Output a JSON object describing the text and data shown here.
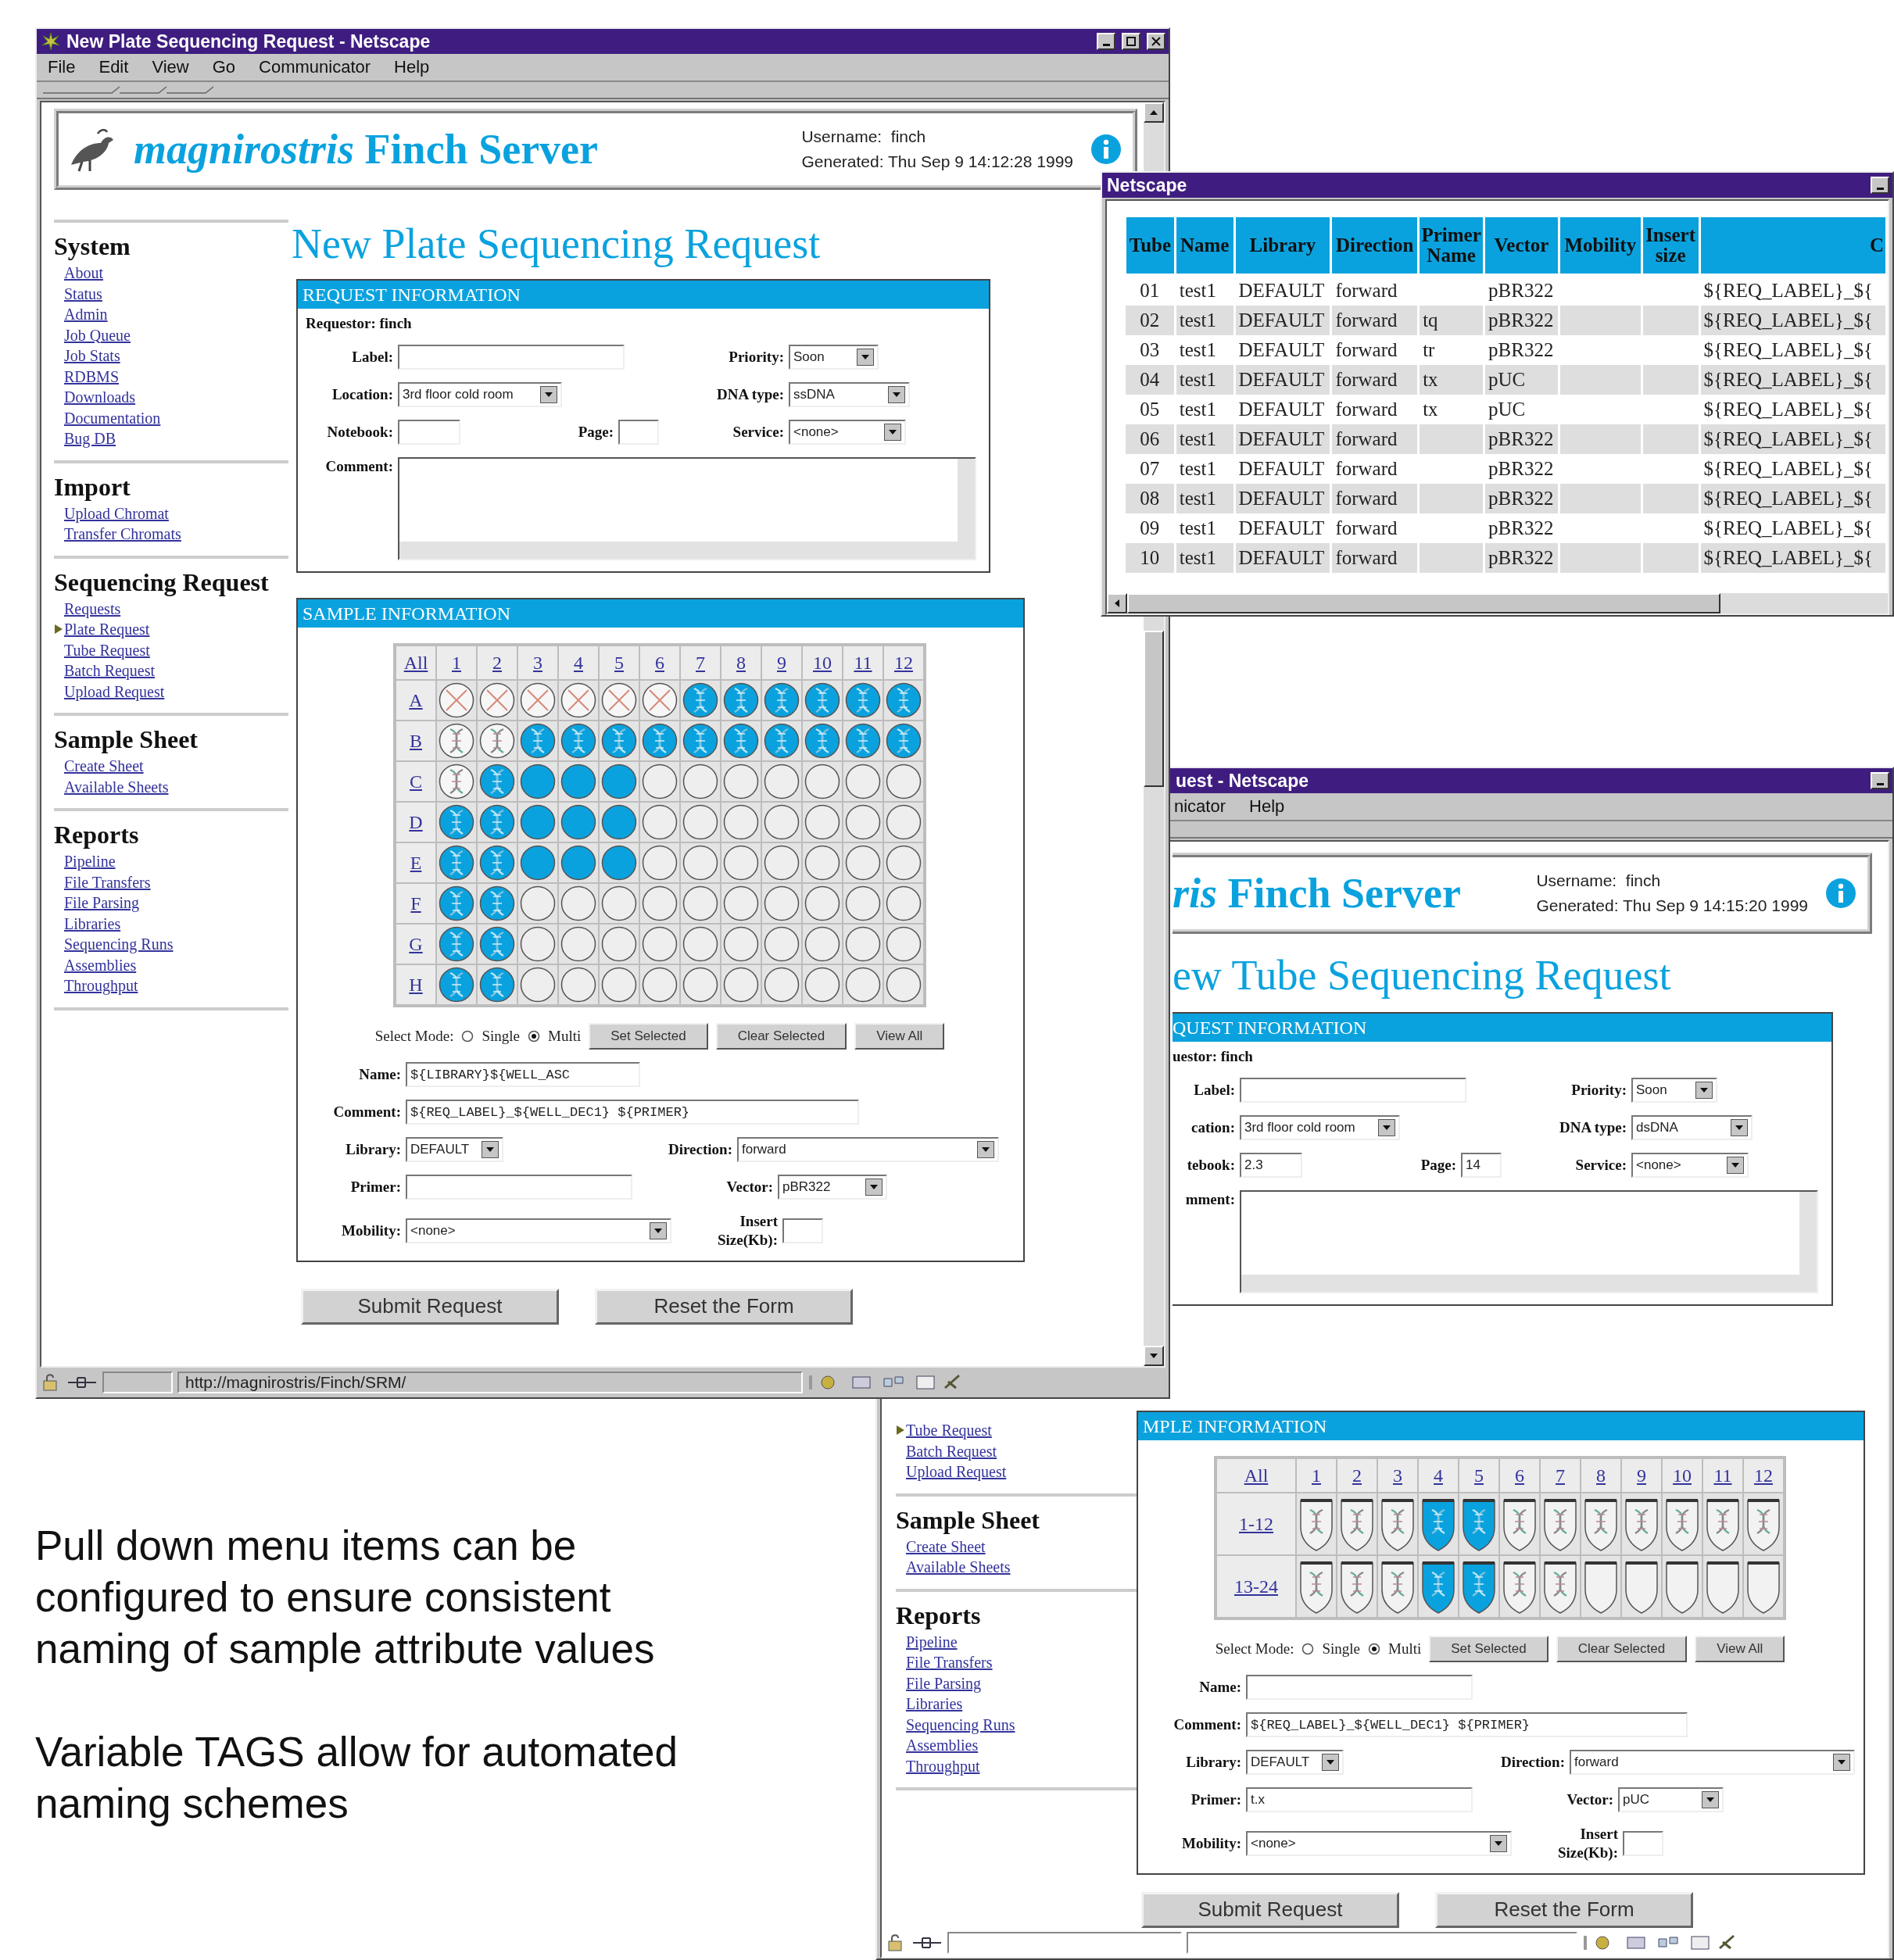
{
  "plate_window": {
    "title": "New Plate Sequencing Request - Netscape",
    "menu": [
      "File",
      "Edit",
      "View",
      "Go",
      "Communicator",
      "Help"
    ],
    "site_header": {
      "logo": "*magnirostris* Finch Server",
      "username": "Username:  finch",
      "generated": "Generated: Thu Sep 9 14:12:28 1999"
    },
    "page_title": "New Plate Sequencing Request",
    "sidebar": [
      {
        "heading": "System",
        "links": [
          {
            "label": "About",
            "selected": false
          },
          {
            "label": "Status",
            "selected": false
          },
          {
            "label": "Admin",
            "selected": false
          },
          {
            "label": "Job Queue",
            "selected": false
          },
          {
            "label": "Job Stats",
            "selected": false
          },
          {
            "label": "RDBMS",
            "selected": false
          },
          {
            "label": "Downloads",
            "selected": false
          },
          {
            "label": "Documentation",
            "selected": false
          },
          {
            "label": "Bug DB",
            "selected": false
          }
        ]
      },
      {
        "heading": "Import",
        "links": [
          {
            "label": "Upload Chromat",
            "selected": false
          },
          {
            "label": "Transfer Chromats",
            "selected": false
          }
        ]
      },
      {
        "heading": "Sequencing Request",
        "links": [
          {
            "label": "Requests",
            "selected": false
          },
          {
            "label": "Plate Request",
            "selected": true
          },
          {
            "label": "Tube Request",
            "selected": false
          },
          {
            "label": "Batch Request",
            "selected": false
          },
          {
            "label": "Upload Request",
            "selected": false
          }
        ]
      },
      {
        "heading": "Sample Sheet",
        "links": [
          {
            "label": "Create Sheet",
            "selected": false
          },
          {
            "label": "Available Sheets",
            "selected": false
          }
        ]
      },
      {
        "heading": "Reports",
        "links": [
          {
            "label": "Pipeline",
            "selected": false
          },
          {
            "label": "File Transfers",
            "selected": false
          },
          {
            "label": "File Parsing",
            "selected": false
          },
          {
            "label": "Libraries",
            "selected": false
          },
          {
            "label": "Sequencing Runs",
            "selected": false
          },
          {
            "label": "Assemblies",
            "selected": false
          },
          {
            "label": "Throughput",
            "selected": false
          }
        ]
      }
    ],
    "request_info": {
      "title": "REQUEST INFORMATION",
      "requestor": "Requestor: finch",
      "rows": [
        [
          {
            "label": "Label:",
            "kind": "text"
          },
          {
            "label": "Priority:",
            "kind": "select",
            "value": "Soon"
          }
        ],
        [
          {
            "label": "Location:",
            "kind": "select",
            "value": "3rd floor cold room"
          },
          {
            "label": "DNA type:",
            "kind": "select",
            "value": "ssDNA"
          }
        ],
        [
          {
            "label": "Notebook:",
            "kind": "text"
          },
          {
            "label": "Page:",
            "kind": "text"
          },
          {
            "label": "Service:",
            "kind": "select",
            "value": "<none>"
          }
        ],
        [
          {
            "label": "Comment:",
            "kind": "textarea"
          }
        ]
      ]
    },
    "sample_info": {
      "title": "SAMPLE INFORMATION",
      "grid": {
        "kind": "plate",
        "columns": [
          "All",
          "1",
          "2",
          "3",
          "4",
          "5",
          "6",
          "7",
          "8",
          "9",
          "10",
          "11",
          "12"
        ],
        "rows": [
          {
            "label": "A",
            "cells": [
              {
                "kind": "crossed"
              },
              {
                "kind": "crossed"
              },
              {
                "kind": "crossed"
              },
              {
                "kind": "crossed"
              },
              {
                "kind": "crossed"
              },
              {
                "kind": "crossed"
              },
              {
                "kind": "selected"
              },
              {
                "kind": "selected"
              },
              {
                "kind": "selected"
              },
              {
                "kind": "selected"
              },
              {
                "kind": "selected"
              },
              {
                "kind": "selected"
              }
            ]
          },
          {
            "label": "B",
            "cells": [
              {
                "kind": "dna"
              },
              {
                "kind": "dna"
              },
              {
                "kind": "selected"
              },
              {
                "kind": "selected"
              },
              {
                "kind": "selected"
              },
              {
                "kind": "selected"
              },
              {
                "kind": "selected"
              },
              {
                "kind": "selected"
              },
              {
                "kind": "selected"
              },
              {
                "kind": "selected"
              },
              {
                "kind": "selected"
              },
              {
                "kind": "selected"
              }
            ]
          },
          {
            "label": "C",
            "cells": [
              {
                "kind": "dna"
              },
              {
                "kind": "selected"
              },
              {
                "kind": "filled"
              },
              {
                "kind": "filled"
              },
              {
                "kind": "filled"
              },
              {
                "kind": "empty"
              },
              {
                "kind": "empty"
              },
              {
                "kind": "empty"
              },
              {
                "kind": "empty"
              },
              {
                "kind": "empty"
              },
              {
                "kind": "empty"
              },
              {
                "kind": "empty"
              }
            ]
          },
          {
            "label": "D",
            "cells": [
              {
                "kind": "selected"
              },
              {
                "kind": "selected"
              },
              {
                "kind": "filled"
              },
              {
                "kind": "filled"
              },
              {
                "kind": "filled"
              },
              {
                "kind": "empty"
              },
              {
                "kind": "empty"
              },
              {
                "kind": "empty"
              },
              {
                "kind": "empty"
              },
              {
                "kind": "empty"
              },
              {
                "kind": "empty"
              },
              {
                "kind": "empty"
              }
            ]
          },
          {
            "label": "E",
            "cells": [
              {
                "kind": "selected"
              },
              {
                "kind": "selected"
              },
              {
                "kind": "filled"
              },
              {
                "kind": "filled"
              },
              {
                "kind": "filled"
              },
              {
                "kind": "empty"
              },
              {
                "kind": "empty"
              },
              {
                "kind": "empty"
              },
              {
                "kind": "empty"
              },
              {
                "kind": "empty"
              },
              {
                "kind": "empty"
              },
              {
                "kind": "empty"
              }
            ]
          },
          {
            "label": "F",
            "cells": [
              {
                "kind": "selected"
              },
              {
                "kind": "selected"
              },
              {
                "kind": "empty"
              },
              {
                "kind": "empty"
              },
              {
                "kind": "empty"
              },
              {
                "kind": "empty"
              },
              {
                "kind": "empty"
              },
              {
                "kind": "empty"
              },
              {
                "kind": "empty"
              },
              {
                "kind": "empty"
              },
              {
                "kind": "empty"
              },
              {
                "kind": "empty"
              }
            ]
          },
          {
            "label": "G",
            "cells": [
              {
                "kind": "selected"
              },
              {
                "kind": "selected"
              },
              {
                "kind": "empty"
              },
              {
                "kind": "empty"
              },
              {
                "kind": "empty"
              },
              {
                "kind": "empty"
              },
              {
                "kind": "empty"
              },
              {
                "kind": "empty"
              },
              {
                "kind": "empty"
              },
              {
                "kind": "empty"
              },
              {
                "kind": "empty"
              },
              {
                "kind": "empty"
              }
            ]
          },
          {
            "label": "H",
            "cells": [
              {
                "kind": "selected"
              },
              {
                "kind": "selected"
              },
              {
                "kind": "empty"
              },
              {
                "kind": "empty"
              },
              {
                "kind": "empty"
              },
              {
                "kind": "empty"
              },
              {
                "kind": "empty"
              },
              {
                "kind": "empty"
              },
              {
                "kind": "empty"
              },
              {
                "kind": "empty"
              },
              {
                "kind": "empty"
              },
              {
                "kind": "empty"
              }
            ]
          }
        ]
      },
      "select_mode": {
        "label": "Select Mode:",
        "options": [
          {
            "label": "Single",
            "selected": false
          },
          {
            "label": "Multi",
            "selected": true
          }
        ]
      },
      "actions": [
        "Set Selected",
        "Clear Selected",
        "View All"
      ],
      "rows": [
        [
          {
            "label": "Name:",
            "kind": "template",
            "value": "${LIBRARY}${WELL_ASC"
          }
        ],
        [
          {
            "label": "Comment:",
            "kind": "template",
            "value": "${REQ_LABEL}_${WELL_DEC1} ${PRIMER}"
          }
        ],
        [
          {
            "label": "Library:",
            "kind": "select",
            "value": "DEFAULT"
          },
          {
            "label": "Direction:",
            "kind": "select",
            "value": "forward"
          }
        ],
        [
          {
            "label": "Primer:",
            "kind": "text"
          },
          {
            "label": "Vector:",
            "kind": "select",
            "value": "pBR322"
          }
        ],
        [
          {
            "label": "Mobility:",
            "kind": "select",
            "value": "<none>"
          },
          {
            "label": "Insert Size(Kb):",
            "kind": "text"
          }
        ]
      ]
    },
    "buttons": [
      "Submit Request",
      "Reset the Form"
    ],
    "status_url": "http://magnirostris/Finch/SRM/"
  },
  "table_window": {
    "title": "Netscape",
    "columns": [
      "Tube",
      "Name",
      "Library",
      "Direction",
      "Primer Name",
      "Vector",
      "Mobility",
      "Insert size",
      "C"
    ],
    "rows": [
      {
        "tube": "01",
        "name": "test1",
        "library": "DEFAULT",
        "direction": "forward",
        "vector": "pBR322",
        "column_9": "${REQ_LABEL}_${"
      },
      {
        "tube": "02",
        "name": "test1",
        "library": "DEFAULT",
        "direction": "forward",
        "primer_name": "tq",
        "vector": "pBR322",
        "column_9": "${REQ_LABEL}_${"
      },
      {
        "tube": "03",
        "name": "test1",
        "library": "DEFAULT",
        "direction": "forward",
        "primer_name": "tr",
        "vector": "pBR322",
        "column_9": "${REQ_LABEL}_${"
      },
      {
        "tube": "04",
        "name": "test1",
        "library": "DEFAULT",
        "direction": "forward",
        "primer_name": "tx",
        "vector": "pUC",
        "column_9": "${REQ_LABEL}_${"
      },
      {
        "tube": "05",
        "name": "test1",
        "library": "DEFAULT",
        "direction": "forward",
        "primer_name": "tx",
        "vector": "pUC",
        "column_9": "${REQ_LABEL}_${"
      },
      {
        "tube": "06",
        "name": "test1",
        "library": "DEFAULT",
        "direction": "forward",
        "vector": "pBR322",
        "column_9": "${REQ_LABEL}_${"
      },
      {
        "tube": "07",
        "name": "test1",
        "library": "DEFAULT",
        "direction": "forward",
        "vector": "pBR322",
        "column_9": "${REQ_LABEL}_${"
      },
      {
        "tube": "08",
        "name": "test1",
        "library": "DEFAULT",
        "direction": "forward",
        "vector": "pBR322",
        "column_9": "${REQ_LABEL}_${"
      },
      {
        "tube": "09",
        "name": "test1",
        "library": "DEFAULT",
        "direction": "forward",
        "vector": "pBR322",
        "column_9": "${REQ_LABEL}_${"
      },
      {
        "tube": "10",
        "name": "test1",
        "library": "DEFAULT",
        "direction": "forward",
        "vector": "pBR322",
        "column_9": "${REQ_LABEL}_${"
      }
    ]
  },
  "tube_window": {
    "title": "uest - Netscape",
    "menu": [
      "nicator",
      "Help"
    ],
    "site_header": {
      "logo": "*ris* Finch Server",
      "username": "Username:  finch",
      "generated": "Generated: Thu Sep 9 14:15:20 1999"
    },
    "page_title": "ew Tube Sequencing Request",
    "request_info": {
      "title": "QUEST INFORMATION",
      "requestor": "uestor: finch",
      "rows": [
        [
          {
            "label": "Label:",
            "kind": "text"
          },
          {
            "label": "Priority:",
            "kind": "select",
            "value": "Soon"
          }
        ],
        [
          {
            "label": "cation:",
            "kind": "select",
            "value": "3rd floor cold room"
          },
          {
            "label": "DNA type:",
            "kind": "select",
            "value": "dsDNA"
          }
        ],
        [
          {
            "label": "tebook:",
            "kind": "text",
            "value": "2.3"
          },
          {
            "label": "Page:",
            "kind": "text",
            "value": "14"
          },
          {
            "label": "Service:",
            "kind": "select",
            "value": "<none>"
          }
        ],
        [
          {
            "label": "mment:",
            "kind": "textarea"
          }
        ]
      ]
    },
    "sidebar": [
      {
        "links": [
          {
            "label": "Tube Request",
            "selected": true
          },
          {
            "label": "Batch Request",
            "selected": false
          },
          {
            "label": "Upload Request",
            "selected": false
          }
        ]
      },
      {
        "heading": "Sample Sheet",
        "links": [
          {
            "label": "Create Sheet",
            "selected": false
          },
          {
            "label": "Available Sheets",
            "selected": false
          }
        ]
      },
      {
        "heading": "Reports",
        "links": [
          {
            "label": "Pipeline",
            "selected": false
          },
          {
            "label": "File Transfers",
            "selected": false
          },
          {
            "label": "File Parsing",
            "selected": false
          },
          {
            "label": "Libraries",
            "selected": false
          },
          {
            "label": "Sequencing Runs",
            "selected": false
          },
          {
            "label": "Assemblies",
            "selected": false
          },
          {
            "label": "Throughput",
            "selected": false
          }
        ]
      }
    ],
    "sample_info": {
      "title": "MPLE INFORMATION",
      "grid": {
        "kind": "tube",
        "columns": [
          "All",
          "1",
          "2",
          "3",
          "4",
          "5",
          "6",
          "7",
          "8",
          "9",
          "10",
          "11",
          "12"
        ],
        "rows": [
          {
            "label": "1-12",
            "cells": [
              {
                "kind": "dna"
              },
              {
                "kind": "dna"
              },
              {
                "kind": "dna"
              },
              {
                "kind": "selected"
              },
              {
                "kind": "selected"
              },
              {
                "kind": "dna"
              },
              {
                "kind": "dna"
              },
              {
                "kind": "dna"
              },
              {
                "kind": "dna"
              },
              {
                "kind": "dna"
              },
              {
                "kind": "dna"
              },
              {
                "kind": "dna"
              }
            ]
          },
          {
            "label": "13-24",
            "cells": [
              {
                "kind": "dna"
              },
              {
                "kind": "dna"
              },
              {
                "kind": "dna"
              },
              {
                "kind": "selected"
              },
              {
                "kind": "selected"
              },
              {
                "kind": "dna"
              },
              {
                "kind": "dna"
              },
              {
                "kind": "empty"
              },
              {
                "kind": "empty"
              },
              {
                "kind": "empty"
              },
              {
                "kind": "empty"
              },
              {
                "kind": "empty"
              }
            ]
          }
        ]
      },
      "select_mode": {
        "label": "Select Mode:",
        "options": [
          {
            "label": "Single",
            "selected": false
          },
          {
            "label": "Multi",
            "selected": true
          }
        ]
      },
      "actions": [
        "Set Selected",
        "Clear Selected",
        "View All"
      ],
      "rows": [
        [
          {
            "label": "Name:",
            "kind": "text"
          }
        ],
        [
          {
            "label": "Comment:",
            "kind": "template",
            "value": "${REQ_LABEL}_${WELL_DEC1} ${PRIMER}"
          }
        ],
        [
          {
            "label": "Library:",
            "kind": "select",
            "value": "DEFAULT"
          },
          {
            "label": "Direction:",
            "kind": "select",
            "value": "forward"
          }
        ],
        [
          {
            "label": "Primer:",
            "kind": "text",
            "value": "t.x"
          },
          {
            "label": "Vector:",
            "kind": "select",
            "value": "pUC"
          }
        ],
        [
          {
            "label": "Mobility:",
            "kind": "select",
            "value": "<none>"
          },
          {
            "label": "Insert Size(Kb):",
            "kind": "text"
          }
        ]
      ]
    },
    "buttons": [
      "Submit Request",
      "Reset the Form"
    ]
  },
  "caption": [
    "Pull down menu items can be configured to ensure consistent naming of sample attribute values",
    "Variable TAGS allow for automated naming schemes"
  ]
}
